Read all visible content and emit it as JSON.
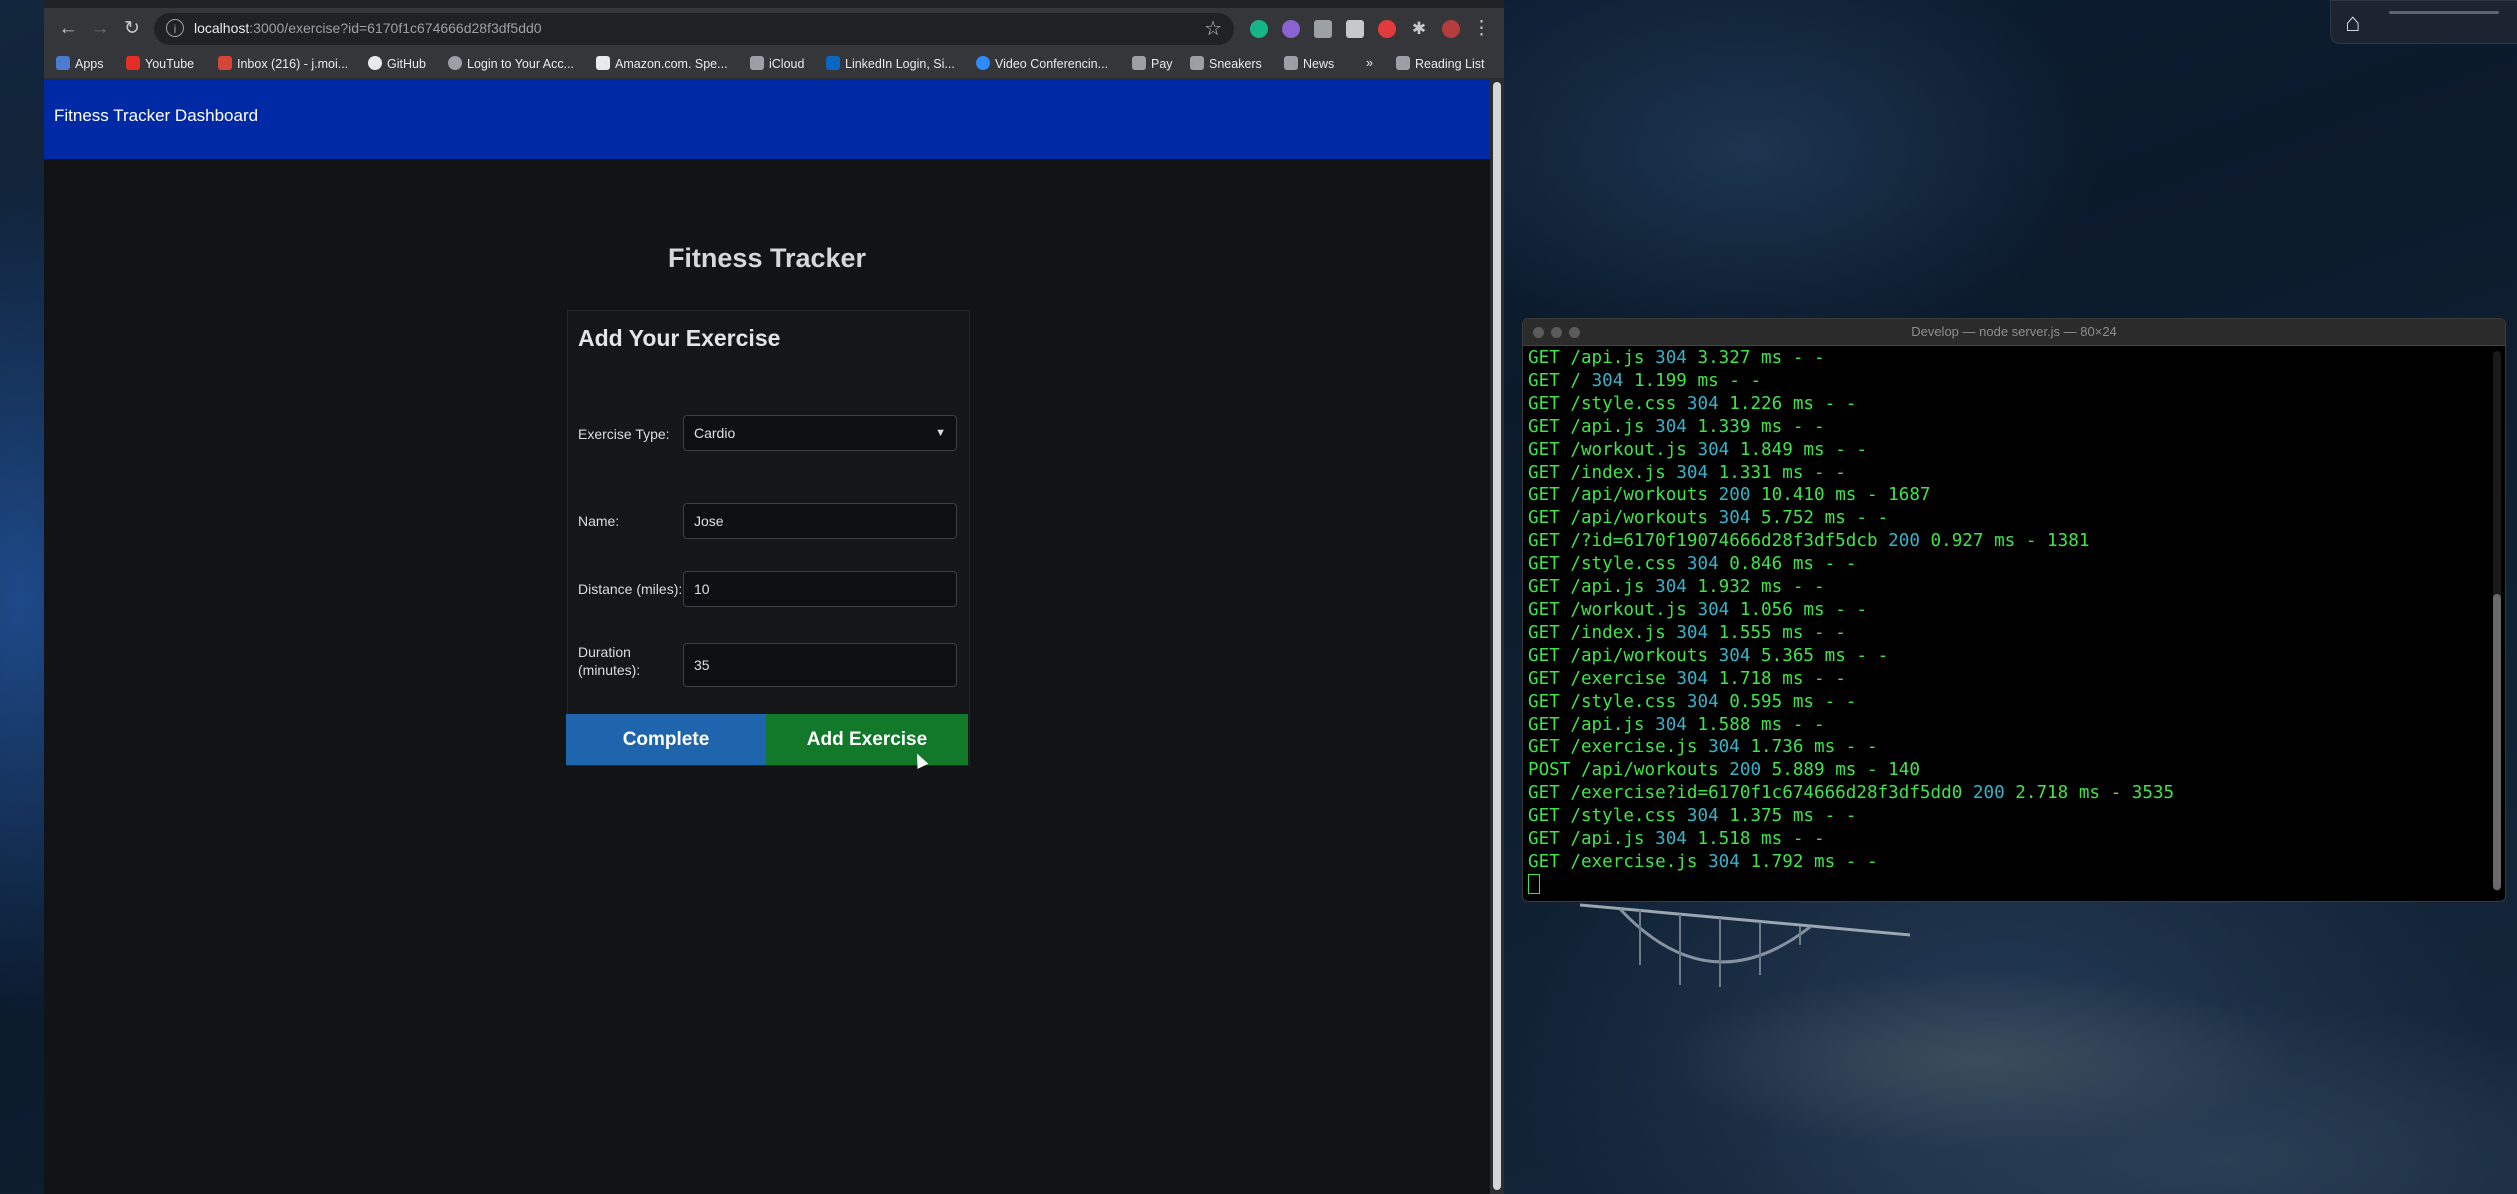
{
  "browser": {
    "url_host": "localhost",
    "url_rest": ":3000/exercise?id=6170f1c674666d28f3df5dd0",
    "bookmarks": [
      {
        "label": "Apps",
        "color": "#4a7bd0"
      },
      {
        "label": "YouTube",
        "color": "#e52d27"
      },
      {
        "label": "Inbox (216) - j.moi...",
        "color": "#d44638"
      },
      {
        "label": "GitHub",
        "color": "#e8eaed"
      },
      {
        "label": "Login to Your Acc...",
        "color": "#9aa0a6"
      },
      {
        "label": "Amazon.com. Spe...",
        "color": "#e8eaed"
      },
      {
        "label": "iCloud",
        "color": "#9aa0a6"
      },
      {
        "label": "LinkedIn Login, Si...",
        "color": "#0a66c2"
      },
      {
        "label": "Video Conferencin...",
        "color": "#2d8cff"
      },
      {
        "label": "Pay",
        "color": "#9aa0a6"
      },
      {
        "label": "Sneakers",
        "color": "#9aa0a6"
      },
      {
        "label": "News",
        "color": "#9aa0a6"
      },
      {
        "label": "»",
        "color": ""
      },
      {
        "label": "Reading List",
        "color": "#9aa0a6"
      }
    ]
  },
  "app": {
    "brand": "Fitness Tracker Dashboard",
    "title": "Fitness Tracker",
    "form": {
      "heading": "Add Your Exercise",
      "exercise_type_label": "Exercise Type:",
      "exercise_type_value": "Cardio",
      "name_label": "Name:",
      "name_value": "Jose",
      "distance_label": "Distance (miles):",
      "distance_value": "10",
      "duration_label": "Duration (minutes):",
      "duration_value": "35",
      "complete_button": "Complete",
      "add_button": "Add Exercise"
    },
    "colors": {
      "nav": "#0029a5",
      "complete": "#1f65ad",
      "add": "#12792a"
    }
  },
  "terminal": {
    "title": "Develop — node server.js — 80×24",
    "lines": [
      {
        "m": "GET",
        "path": "/api.js",
        "code": "304",
        "rest": "3.327 ms - -"
      },
      {
        "m": "GET",
        "path": "/",
        "code": "304",
        "rest": "1.199 ms - -"
      },
      {
        "m": "GET",
        "path": "/style.css",
        "code": "304",
        "rest": "1.226 ms - -"
      },
      {
        "m": "GET",
        "path": "/api.js",
        "code": "304",
        "rest": "1.339 ms - -"
      },
      {
        "m": "GET",
        "path": "/workout.js",
        "code": "304",
        "rest": "1.849 ms - -"
      },
      {
        "m": "GET",
        "path": "/index.js",
        "code": "304",
        "rest": "1.331 ms - -"
      },
      {
        "m": "GET",
        "path": "/api/workouts",
        "code": "200",
        "rest": "10.410 ms - 1687"
      },
      {
        "m": "GET",
        "path": "/api/workouts",
        "code": "304",
        "rest": "5.752 ms - -"
      },
      {
        "m": "GET",
        "path": "/?id=6170f19074666d28f3df5dcb",
        "code": "200",
        "rest": "0.927 ms - 1381"
      },
      {
        "m": "GET",
        "path": "/style.css",
        "code": "304",
        "rest": "0.846 ms - -"
      },
      {
        "m": "GET",
        "path": "/api.js",
        "code": "304",
        "rest": "1.932 ms - -"
      },
      {
        "m": "GET",
        "path": "/workout.js",
        "code": "304",
        "rest": "1.056 ms - -"
      },
      {
        "m": "GET",
        "path": "/index.js",
        "code": "304",
        "rest": "1.555 ms - -"
      },
      {
        "m": "GET",
        "path": "/api/workouts",
        "code": "304",
        "rest": "5.365 ms - -"
      },
      {
        "m": "GET",
        "path": "/exercise",
        "code": "304",
        "rest": "1.718 ms - -"
      },
      {
        "m": "GET",
        "path": "/style.css",
        "code": "304",
        "rest": "0.595 ms - -"
      },
      {
        "m": "GET",
        "path": "/api.js",
        "code": "304",
        "rest": "1.588 ms - -"
      },
      {
        "m": "GET",
        "path": "/exercise.js",
        "code": "304",
        "rest": "1.736 ms - -"
      },
      {
        "m": "POST",
        "path": "/api/workouts",
        "code": "200",
        "rest": "5.889 ms - 140"
      },
      {
        "m": "GET",
        "path": "/exercise?id=6170f1c674666d28f3df5dd0",
        "code": "200",
        "rest": "2.718 ms - 3535"
      },
      {
        "m": "GET",
        "path": "/style.css",
        "code": "304",
        "rest": "1.375 ms - -"
      },
      {
        "m": "GET",
        "path": "/api.js",
        "code": "304",
        "rest": "1.518 ms - -"
      },
      {
        "m": "GET",
        "path": "/exercise.js",
        "code": "304",
        "rest": "1.792 ms - -"
      }
    ]
  }
}
